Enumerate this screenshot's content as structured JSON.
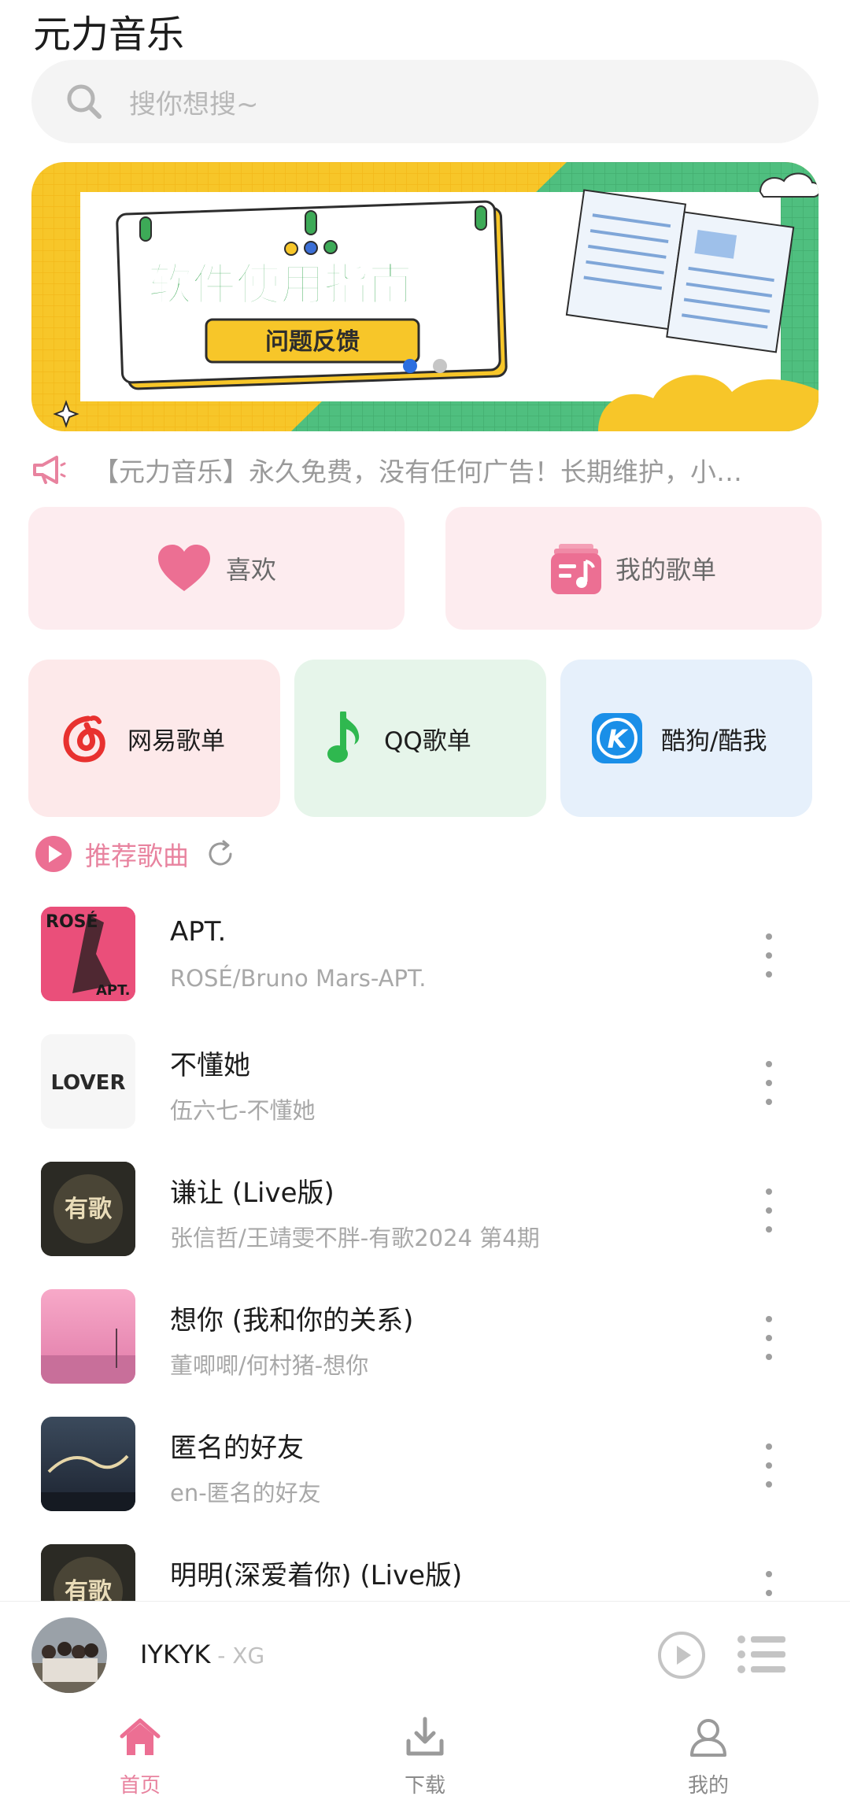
{
  "app": {
    "title": "元力音乐"
  },
  "search": {
    "placeholder": "搜你想搜~"
  },
  "banner": {
    "title": "软件使用指南",
    "button": "问题反馈",
    "active_index": 0,
    "count": 2,
    "colors": {
      "yellow": "#f7c629",
      "green": "#4fbf7f",
      "title": "#3daa57"
    }
  },
  "notice": {
    "text": "【元力音乐】永久免费，没有任何广告！长期维护，小…"
  },
  "quick": {
    "favorites": {
      "label": "喜欢",
      "icon": "heart-icon"
    },
    "playlists": {
      "label": "我的歌单",
      "icon": "playlist-icon"
    }
  },
  "sources": [
    {
      "label": "网易歌单",
      "icon": "netease-icon",
      "bg": "#fde9ea"
    },
    {
      "label": "QQ歌单",
      "icon": "qq-music-icon",
      "bg": "#e6f5ea"
    },
    {
      "label": "酷狗/酷我",
      "icon": "kugou-icon",
      "bg": "#e6f0fb"
    }
  ],
  "recommend": {
    "label": "推荐歌曲"
  },
  "songs": [
    {
      "title": "APT.",
      "subtitle": "ROSÉ/Bruno Mars-APT.",
      "cover_text": "ROSÉ",
      "cover_text2": "APT."
    },
    {
      "title": "不懂她",
      "subtitle": "伍六七-不懂她",
      "cover_text": "LOVER"
    },
    {
      "title": "谦让 (Live版)",
      "subtitle": "张信哲/王靖雯不胖-有歌2024 第4期",
      "cover_text": "有歌"
    },
    {
      "title": "想你 (我和你的关系)",
      "subtitle": "董唧唧/何村猪-想你"
    },
    {
      "title": "匿名的好友",
      "subtitle": "en-匿名的好友"
    },
    {
      "title": "明明(深爱着你) (Live版)",
      "subtitle": "",
      "cover_text": "有歌"
    }
  ],
  "player": {
    "title": "IYKYK",
    "artist": "XG"
  },
  "tabs": [
    {
      "label": "首页",
      "icon": "home-icon"
    },
    {
      "label": "下载",
      "icon": "download-icon"
    },
    {
      "label": "我的",
      "icon": "user-icon"
    }
  ],
  "colors": {
    "accent": "#e8839f",
    "netease": "#e8312f",
    "qq": "#2fb84f",
    "kugou": "#1a8fe8"
  }
}
